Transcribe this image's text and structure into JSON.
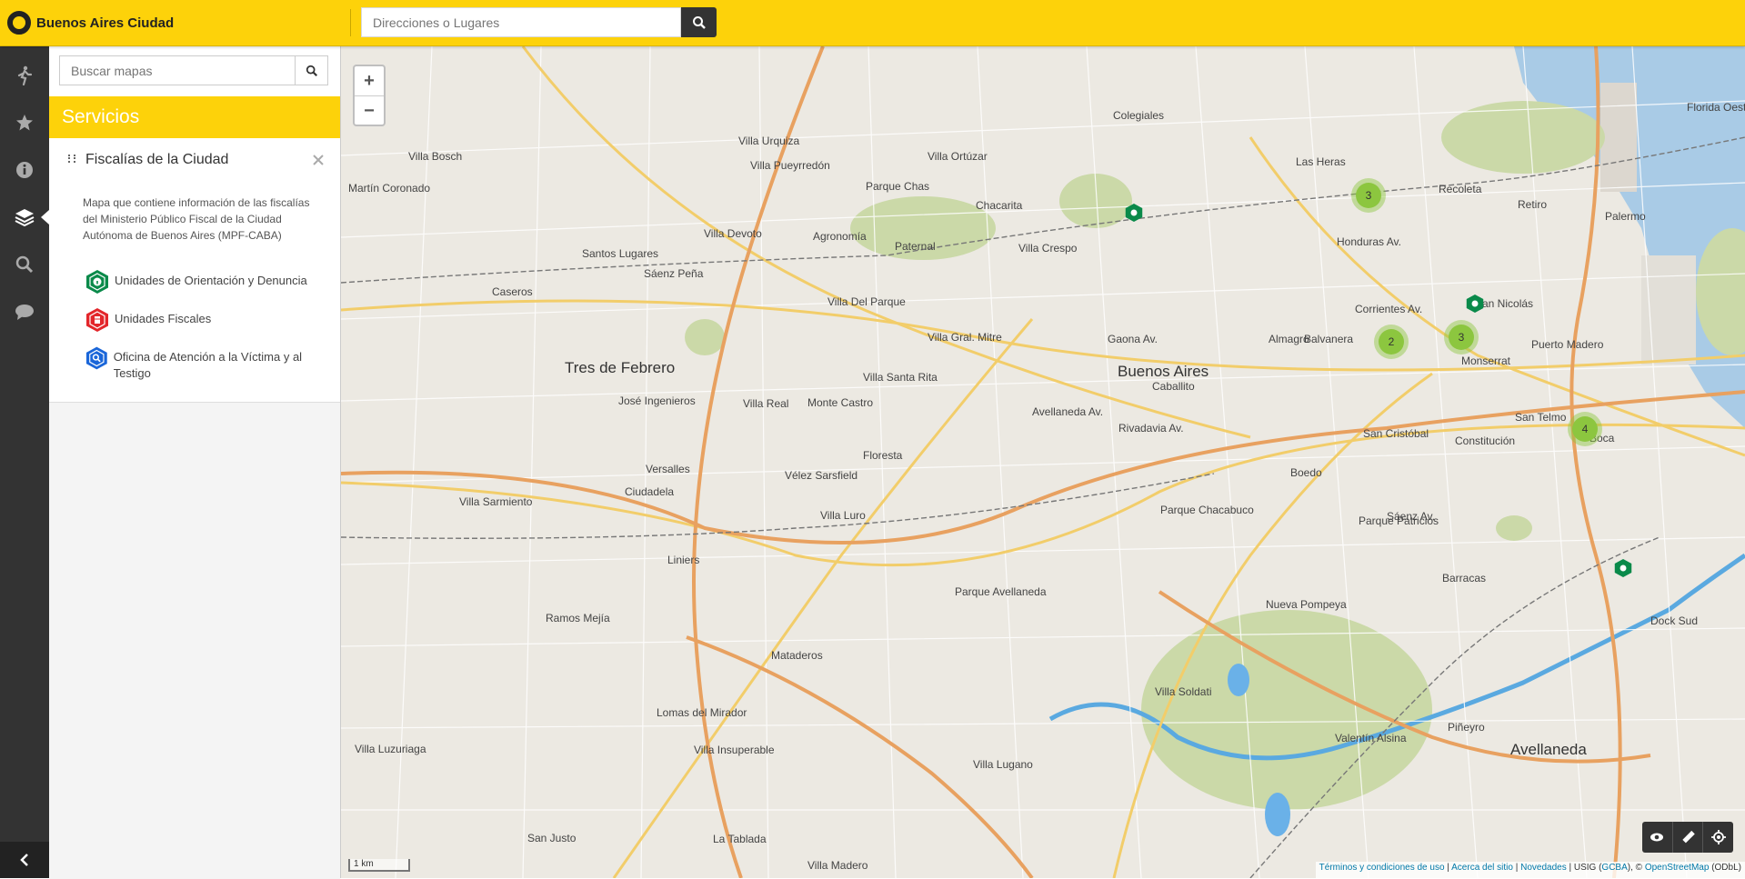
{
  "header": {
    "logo_text": "Buenos Aires Ciudad",
    "address_placeholder": "Direcciones o Lugares",
    "brand_color": "#fdd20a"
  },
  "rail": {
    "items": [
      {
        "icon": "walking-icon"
      },
      {
        "icon": "star-icon"
      },
      {
        "icon": "info-icon"
      },
      {
        "icon": "layers-icon",
        "active": true
      },
      {
        "icon": "search-icon"
      },
      {
        "icon": "chat-bubble-icon"
      }
    ],
    "collapse_icon": "chevron-left-icon"
  },
  "panel": {
    "search_placeholder": "Buscar mapas",
    "section_title": "Servicios",
    "layer": {
      "title": "Fiscalías de la Ciudad",
      "description": "Mapa que contiene información de las fiscalías del Ministerio Público Fiscal de la Ciudad Autónoma de Buenos Aires (MPF-CABA)",
      "legend": [
        {
          "label": "Unidades de Orientación y Denuncia",
          "color": "#0a8a4a",
          "icon": "info-icon"
        },
        {
          "label": "Unidades Fiscales",
          "color": "#e3262b",
          "icon": "building-icon"
        },
        {
          "label": "Oficina de Atención a la Víctima y al Testigo",
          "color": "#1a66d9",
          "icon": "magnifier-icon"
        }
      ]
    }
  },
  "map": {
    "zoom_in": "+",
    "zoom_out": "−",
    "scale": "1 km",
    "labels": [
      "Villa Urquiza",
      "Colegiales",
      "Villa Ortúzar",
      "Villa Pueyrredón",
      "Parque Chas",
      "Chacarita",
      "Agronomía",
      "Paternal",
      "Villa Crespo",
      "Villa Devoto",
      "Santos Lugares",
      "Sáenz Peña",
      "Villa Del Parque",
      "Almagro",
      "Balvanera",
      "Buenos Aires",
      "Caballito",
      "Villa Gral. Mitre",
      "Villa Santa Rita",
      "Monte Castro",
      "Villa Real",
      "Floresta",
      "Vélez Sarsfield",
      "Versalles",
      "Ciudadela",
      "Villa Luro",
      "Liniers",
      "Villa Sarmiento",
      "Ramos Mejía",
      "Mataderos",
      "Parque Avellaneda",
      "Parque Chacabuco",
      "Boedo",
      "San Cristóbal",
      "Constitución",
      "Recoleta",
      "Retiro",
      "San Nicolás",
      "Monserrat",
      "Puerto Madero",
      "San Telmo",
      "Boca",
      "Barracas",
      "Nueva Pompeya",
      "Parque Patricios",
      "Villa Soldati",
      "Villa Lugano",
      "Villa Madero",
      "Lomas del Mirador",
      "Dock Sud",
      "Avellaneda",
      "Valentín Alsina",
      "Piñeyro",
      "Villa Bosch",
      "Martín Coronado",
      "Caseros",
      "Tres de Febrero",
      "José Ingenieros",
      "Villa Luzuriaga",
      "San Justo",
      "La Tablada",
      "Villa Insuperable",
      "Palermo",
      "Las Heras",
      "Florida Oeste",
      "Honduras Av.",
      "Corrientes Av.",
      "Rivadavia Av.",
      "Gaona Av.",
      "Avellaneda Av.",
      "Sáenz Av."
    ],
    "clusters": [
      "3",
      "2",
      "3",
      "4"
    ],
    "attribution": {
      "terms": "Términos y condiciones de uso",
      "about": "Acerca del sitio",
      "news": "Novedades",
      "usig": "USIG",
      "gcba": "GCBA",
      "osm": "OpenStreetMap",
      "odbl": "(ODbL)"
    },
    "tools": [
      "eye-icon",
      "ruler-icon",
      "locate-icon"
    ]
  }
}
